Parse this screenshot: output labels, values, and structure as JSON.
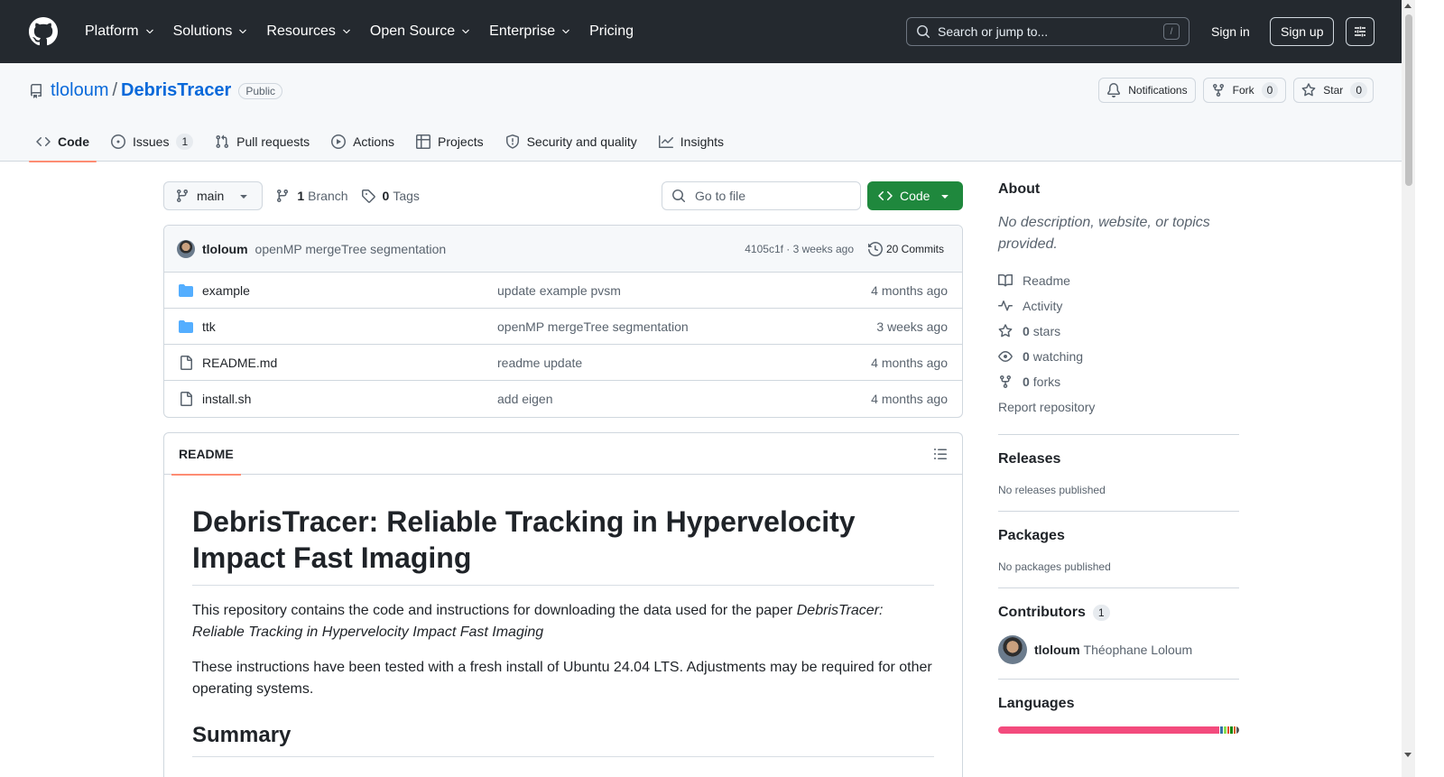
{
  "header": {
    "nav": [
      "Platform",
      "Solutions",
      "Resources",
      "Open Source",
      "Enterprise",
      "Pricing"
    ],
    "nav_has_dropdown": [
      true,
      true,
      true,
      true,
      true,
      false
    ],
    "search_placeholder": "Search or jump to...",
    "search_shortcut": "/",
    "signin_label": "Sign in",
    "signup_label": "Sign up"
  },
  "repo": {
    "owner": "tloloum",
    "separator": "/",
    "name": "DebrisTracer",
    "visibility": "Public",
    "notifications_label": "Notifications",
    "fork_label": "Fork",
    "fork_count": "0",
    "star_label": "Star",
    "star_count": "0"
  },
  "tabs": [
    {
      "label": "Code",
      "icon": "code-icon",
      "active": true
    },
    {
      "label": "Issues",
      "icon": "issue-icon",
      "count": "1"
    },
    {
      "label": "Pull requests",
      "icon": "pull-request-icon"
    },
    {
      "label": "Actions",
      "icon": "play-icon"
    },
    {
      "label": "Projects",
      "icon": "table-icon"
    },
    {
      "label": "Security and quality",
      "icon": "shield-icon"
    },
    {
      "label": "Insights",
      "icon": "graph-icon"
    }
  ],
  "toolbar": {
    "branch": "main",
    "branch_count": "1",
    "branch_label": "Branch",
    "tag_count": "0",
    "tag_label": "Tags",
    "goto_placeholder": "Go to file",
    "code_label": "Code"
  },
  "latest_commit": {
    "author": "tloloum",
    "message": "openMP mergeTree segmentation",
    "hash_time": "4105c1f · 3 weeks ago",
    "commits_label": "20 Commits"
  },
  "files": [
    {
      "name": "example",
      "type": "dir",
      "message": "update example pvsm",
      "time": "4 months ago"
    },
    {
      "name": "ttk",
      "type": "dir",
      "message": "openMP mergeTree segmentation",
      "time": "3 weeks ago"
    },
    {
      "name": "README.md",
      "type": "file",
      "message": "readme update",
      "time": "4 months ago"
    },
    {
      "name": "install.sh",
      "type": "file",
      "message": "add eigen",
      "time": "4 months ago"
    }
  ],
  "readme": {
    "tab_label": "README",
    "title": "DebrisTracer: Reliable Tracking in Hypervelocity Impact Fast Imaging",
    "p1_text": "This repository contains the code and instructions for downloading the data used for the paper ",
    "p1_italic": "DebrisTracer: Reliable Tracking in Hypervelocity Impact Fast Imaging",
    "p2": "These instructions have been tested with a fresh install of Ubuntu 24.04 LTS. Adjustments may be required for other operating systems.",
    "h2": "Summary"
  },
  "sidebar": {
    "about_title": "About",
    "about_desc": "No description, website, or topics provided.",
    "readme_label": "Readme",
    "activity_label": "Activity",
    "stars_count": "0",
    "stars_label": "stars",
    "watching_count": "0",
    "watching_label": "watching",
    "forks_count": "0",
    "forks_label": "forks",
    "report_label": "Report repository",
    "releases_title": "Releases",
    "releases_empty": "No releases published",
    "packages_title": "Packages",
    "packages_empty": "No packages published",
    "contributors_title": "Contributors",
    "contributors_count": "1",
    "contributor_login": "tloloum",
    "contributor_name": "Théophane Loloum",
    "languages_title": "Languages",
    "language_bar_colors": [
      "#f34b7d",
      "#3572A5",
      "#89e051",
      "#e34c26",
      "#178600",
      "#DA5B0B",
      "#555555"
    ],
    "language_bar_shares": [
      0.94,
      0.01,
      0.01,
      0.01,
      0.01,
      0.01,
      0.01
    ]
  }
}
